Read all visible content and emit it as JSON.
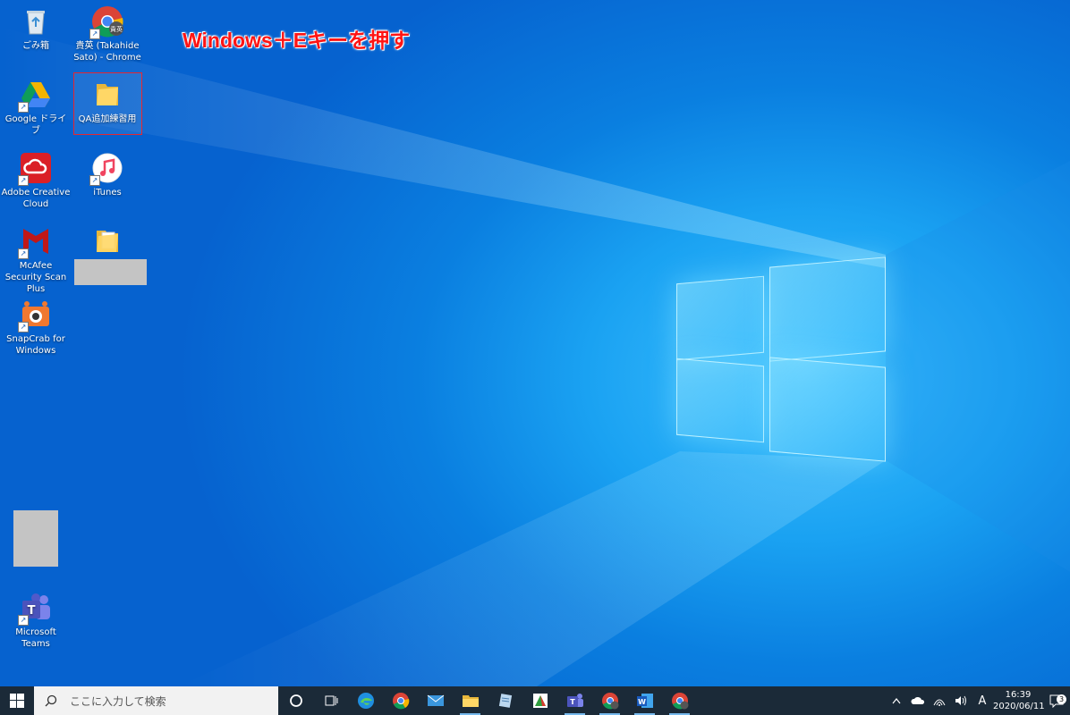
{
  "annotation": "Windows＋Eキーを押す",
  "desktop_icons": [
    {
      "label": "ごみ箱",
      "icon": "recycle-bin-icon"
    },
    {
      "label": "貴英 (Takahide Sato) - Chrome",
      "icon": "chrome-profile-icon",
      "badge": "貴英"
    },
    {
      "label": "Google ドライブ",
      "icon": "google-drive-icon"
    },
    {
      "label": "QA追加練習用",
      "icon": "folder-icon"
    },
    {
      "label": "Adobe Creative Cloud",
      "icon": "adobe-creative-cloud-icon"
    },
    {
      "label": "iTunes",
      "icon": "itunes-icon"
    },
    {
      "label": "McAfee Security Scan Plus",
      "icon": "mcafee-icon"
    },
    {
      "label": "",
      "icon": "folder-icon"
    },
    {
      "label": "SnapCrab for Windows",
      "icon": "snapcrab-icon"
    },
    {
      "label": "Microsoft Teams",
      "icon": "teams-icon"
    }
  ],
  "taskbar": {
    "search_placeholder": "ここに入力して検索",
    "apps": [
      "cortana-icon",
      "task-view-icon",
      "edge-icon",
      "chrome-icon",
      "mail-icon",
      "file-explorer-icon",
      "notepad-icon",
      "app-icon",
      "teams-icon",
      "chrome-profile-icon",
      "word-icon",
      "chrome-profile-icon"
    ],
    "ime": "A",
    "time": "16:39",
    "date": "2020/06/11",
    "notification_count": "3"
  },
  "colors": {
    "annotation": "#ff1414",
    "taskbar": "#1b2a38",
    "selection": "#e8262f"
  }
}
